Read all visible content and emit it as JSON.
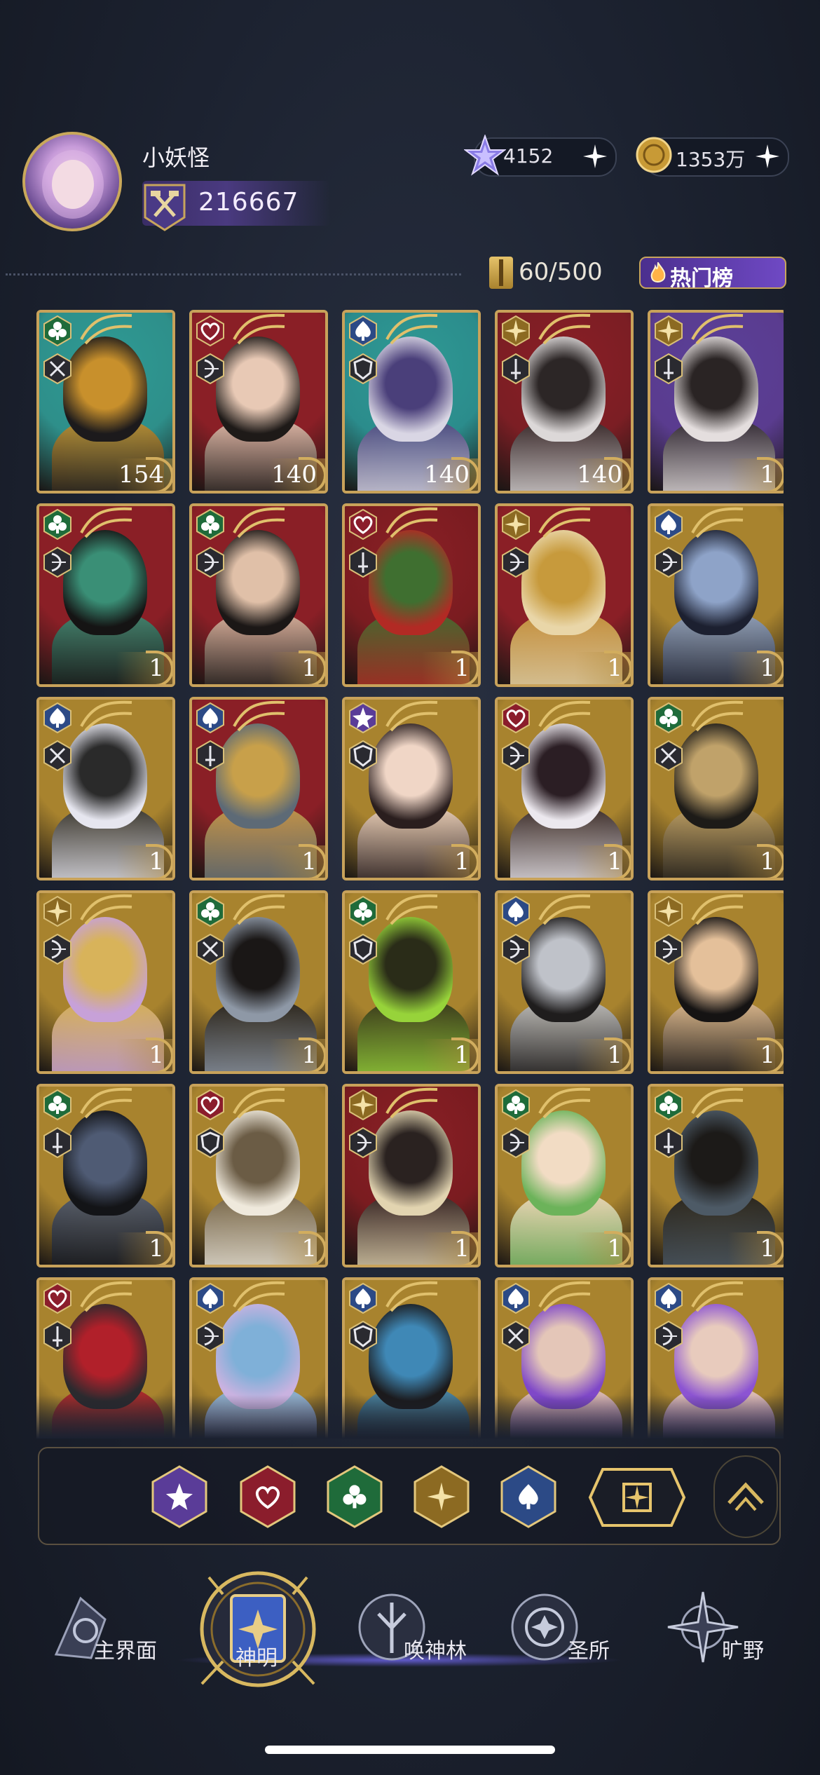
{
  "header": {
    "username": "小妖怪",
    "power": "216667",
    "gems": "4152",
    "gold": "1353万",
    "plus": "+"
  },
  "collection": {
    "capacity": "60/500",
    "hot_button": "热门榜"
  },
  "colors": {
    "club": "#1f6b3a",
    "heart": "#8b1d2c",
    "spade": "#2c4a86",
    "star": "#5a3c98",
    "diamond": "#8c6a22",
    "gold_frame": "#c8a25a"
  },
  "cards": [
    {
      "suit": "club",
      "class": "spear",
      "level": "154",
      "frame": "teal",
      "palette": [
        "#2e8f8a",
        "#1c1a1c",
        "#c8902c"
      ]
    },
    {
      "suit": "heart",
      "class": "bow",
      "level": "140",
      "frame": "red",
      "palette": [
        "#8a1f26",
        "#1e1a18",
        "#e8c9b5"
      ]
    },
    {
      "suit": "spade",
      "class": "shield",
      "level": "140",
      "frame": "teal",
      "palette": [
        "#2b8c8c",
        "#d9d6e4",
        "#4a3f7a"
      ]
    },
    {
      "suit": "diamond",
      "class": "sword",
      "level": "140",
      "frame": "red",
      "palette": [
        "#7b1e24",
        "#dcd8d8",
        "#2c2626"
      ]
    },
    {
      "suit": "diamond",
      "class": "sword",
      "level": "1",
      "frame": "purple",
      "palette": [
        "#5a3c8f",
        "#e4dede",
        "#2a2424"
      ]
    },
    {
      "suit": "club",
      "class": "bow",
      "level": "1",
      "frame": "red",
      "palette": [
        "#8a1f26",
        "#151414",
        "#3a8f76"
      ]
    },
    {
      "suit": "club",
      "class": "bow",
      "level": "1",
      "frame": "red",
      "palette": [
        "#8a1f26",
        "#1b1716",
        "#e0c0a8"
      ]
    },
    {
      "suit": "heart",
      "class": "sword",
      "level": "1",
      "frame": "red",
      "palette": [
        "#7a1c20",
        "#b22a24",
        "#3f6f30"
      ]
    },
    {
      "suit": "diamond",
      "class": "bow",
      "level": "1",
      "frame": "red",
      "palette": [
        "#8a1f26",
        "#e9d6a8",
        "#c79a3c"
      ]
    },
    {
      "suit": "spade",
      "class": "bow",
      "level": "1",
      "frame": "gold",
      "palette": [
        "#a8832e",
        "#1c2030",
        "#8ea3c8"
      ]
    },
    {
      "suit": "spade",
      "class": "spear",
      "level": "1",
      "frame": "gold",
      "palette": [
        "#a8832e",
        "#e6e6ef",
        "#2a2a2a"
      ]
    },
    {
      "suit": "spade",
      "class": "sword",
      "level": "1",
      "frame": "red",
      "palette": [
        "#8a1f26",
        "#5d6a76",
        "#c8a04a"
      ]
    },
    {
      "suit": "star",
      "class": "shield",
      "level": "1",
      "frame": "gold",
      "palette": [
        "#a8832e",
        "#2a1e1e",
        "#f0d6c6"
      ]
    },
    {
      "suit": "heart",
      "class": "bow",
      "level": "1",
      "frame": "gold",
      "palette": [
        "#a8832e",
        "#ece8ee",
        "#2b1e24"
      ]
    },
    {
      "suit": "club",
      "class": "spear",
      "level": "1",
      "frame": "gold",
      "palette": [
        "#a8832e",
        "#1d1b18",
        "#c0a26a"
      ]
    },
    {
      "suit": "diamond",
      "class": "bow",
      "level": "1",
      "frame": "gold",
      "palette": [
        "#a8832e",
        "#c7a1d8",
        "#d8b35a"
      ]
    },
    {
      "suit": "club",
      "class": "spear",
      "level": "1",
      "frame": "gold",
      "palette": [
        "#a8832e",
        "#8e98a6",
        "#1a1716"
      ]
    },
    {
      "suit": "club",
      "class": "shield",
      "level": "1",
      "frame": "gold",
      "palette": [
        "#a8832e",
        "#97d33a",
        "#2a2c18"
      ]
    },
    {
      "suit": "spade",
      "class": "bow",
      "level": "1",
      "frame": "gold",
      "palette": [
        "#a8832e",
        "#1f1d1d",
        "#bfc2c9"
      ]
    },
    {
      "suit": "diamond",
      "class": "bow",
      "level": "1",
      "frame": "gold",
      "palette": [
        "#a8832e",
        "#151313",
        "#e4c09a"
      ]
    },
    {
      "suit": "club",
      "class": "sword",
      "level": "1",
      "frame": "gold",
      "palette": [
        "#a8832e",
        "#131417",
        "#4f5b74"
      ]
    },
    {
      "suit": "heart",
      "class": "shield",
      "level": "1",
      "frame": "gold",
      "palette": [
        "#a8832e",
        "#efe9dc",
        "#6b5c45"
      ]
    },
    {
      "suit": "diamond",
      "class": "bow",
      "level": "1",
      "frame": "red",
      "palette": [
        "#7a1c20",
        "#e2d4b0",
        "#2a2220"
      ]
    },
    {
      "suit": "club",
      "class": "bow",
      "level": "1",
      "frame": "gold",
      "palette": [
        "#a8832e",
        "#6cb35a",
        "#f2dcc4"
      ]
    },
    {
      "suit": "club",
      "class": "sword",
      "level": "1",
      "frame": "gold",
      "palette": [
        "#a8832e",
        "#4d5a66",
        "#1c1a18"
      ]
    },
    {
      "suit": "heart",
      "class": "sword",
      "level": "",
      "frame": "gold",
      "palette": [
        "#a8832e",
        "#2b2a2e",
        "#b1202a"
      ]
    },
    {
      "suit": "spade",
      "class": "bow",
      "level": "",
      "frame": "gold",
      "palette": [
        "#a8832e",
        "#c9b2e0",
        "#7fb0d8"
      ]
    },
    {
      "suit": "spade",
      "class": "shield",
      "level": "",
      "frame": "gold",
      "palette": [
        "#a8832e",
        "#1b1a1c",
        "#3f88b6"
      ]
    },
    {
      "suit": "spade",
      "class": "spear",
      "level": "",
      "frame": "gold",
      "palette": [
        "#a8832e",
        "#7f48c8",
        "#e4c6b8"
      ]
    },
    {
      "suit": "spade",
      "class": "bow",
      "level": "",
      "frame": "gold",
      "palette": [
        "#a8832e",
        "#8c54d2",
        "#e8cbbd"
      ]
    }
  ],
  "filters": [
    {
      "name": "star",
      "color": "#5a3c98"
    },
    {
      "name": "heart",
      "color": "#8b1d2c"
    },
    {
      "name": "club",
      "color": "#1f6b3a"
    },
    {
      "name": "diamond",
      "color": "#8c6a22"
    },
    {
      "name": "spade",
      "color": "#2c4a86"
    }
  ],
  "nav": [
    {
      "label": "主界面",
      "icon": "main-world-icon"
    },
    {
      "label": "神明",
      "icon": "gods-book-icon",
      "active": true
    },
    {
      "label": "唤神林",
      "icon": "summon-tree-icon"
    },
    {
      "label": "圣所",
      "icon": "sanctuary-icon"
    },
    {
      "label": "旷野",
      "icon": "compass-icon"
    }
  ]
}
